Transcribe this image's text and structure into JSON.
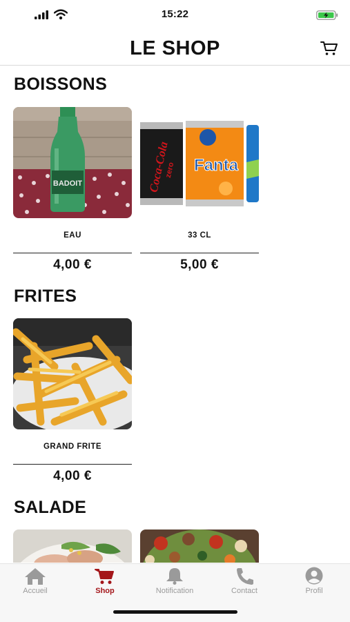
{
  "status_bar": {
    "time": "15:22"
  },
  "header": {
    "title": "LE SHOP",
    "cart_icon": "cart-icon"
  },
  "sections": [
    {
      "title": "BOISSONS",
      "products": [
        {
          "name": "EAU",
          "price": "4,00 €",
          "image": "water-bottle-image"
        },
        {
          "name": "33 CL",
          "price": "5,00 €",
          "image": "soda-cans-image"
        }
      ]
    },
    {
      "title": "FRITES",
      "products": [
        {
          "name": "GRAND FRITE",
          "price": "4,00 €",
          "image": "fries-image"
        }
      ]
    },
    {
      "title": "SALADE",
      "products": [
        {
          "image": "chicken-salad-image"
        },
        {
          "image": "mixed-salad-image"
        }
      ]
    }
  ],
  "tab_bar": {
    "active_color": "#a4161a",
    "inactive_color": "#9a9a9a",
    "items": [
      {
        "label": "Accueil",
        "icon": "home-icon"
      },
      {
        "label": "Shop",
        "icon": "cart-icon",
        "active": true
      },
      {
        "label": "Notification",
        "icon": "bell-icon"
      },
      {
        "label": "Contact",
        "icon": "phone-icon"
      },
      {
        "label": "Profil",
        "icon": "user-icon"
      }
    ]
  }
}
